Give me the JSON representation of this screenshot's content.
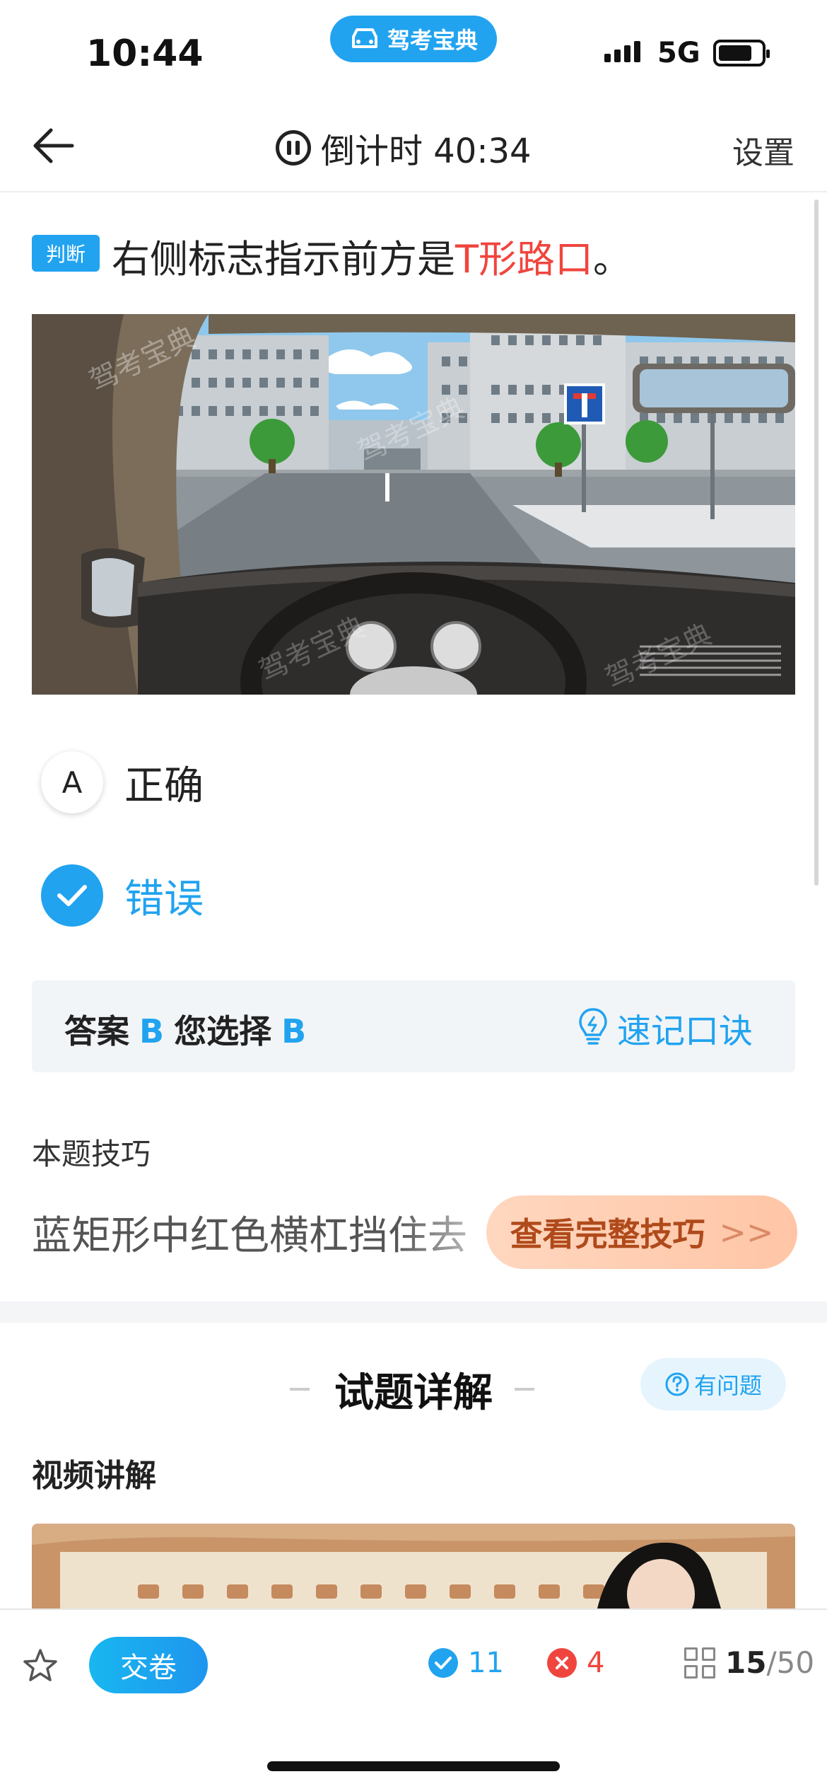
{
  "status_bar": {
    "time": "10:44",
    "app_badge": "驾考宝典",
    "network": "5G"
  },
  "nav": {
    "countdown": "倒计时 40:34",
    "settings": "设置"
  },
  "question": {
    "type_badge": "判断",
    "text_before": "右侧标志指示前方是",
    "text_highlight": "T形路口",
    "text_after": "。",
    "watermark": "驾考宝典"
  },
  "options": [
    {
      "letter": "A",
      "label": "正确",
      "selected": false
    },
    {
      "letter": "B",
      "label": "错误",
      "selected": true
    }
  ],
  "answer_box": {
    "answer_label": "答案",
    "answer": "B",
    "choice_label": "您选择",
    "choice": "B",
    "mnemonic": "速记口诀"
  },
  "tip": {
    "title": "本题技巧",
    "text": "蓝矩形中红色横杠挡住去",
    "button": "查看完整技巧",
    "button_chevron": ">>"
  },
  "details": {
    "title": "试题详解",
    "question_button": "有问题",
    "video_title": "视频讲解"
  },
  "bottom_bar": {
    "submit": "交卷",
    "correct_count": "11",
    "wrong_count": "4",
    "current": "15",
    "total": "/50"
  },
  "colors": {
    "accent": "#21a3f0",
    "highlight": "#f0453e",
    "tip_button": "#ffc5a6"
  }
}
